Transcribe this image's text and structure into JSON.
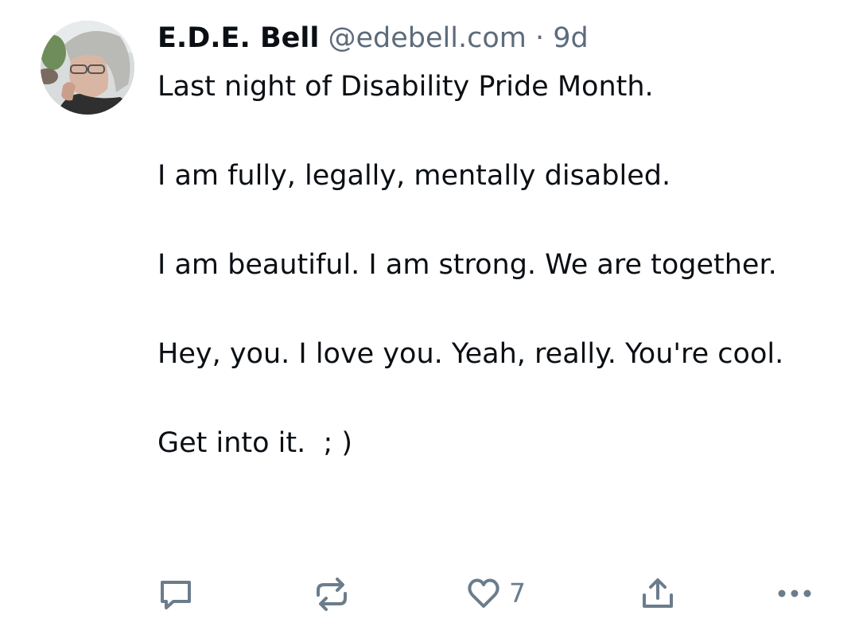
{
  "post": {
    "author": {
      "display_name": "E.D.E. Bell",
      "handle": "@edebell.com",
      "separator": "·",
      "age": "9d"
    },
    "paragraphs": [
      "Last night of Disability Pride Month.",
      "I am fully, legally, mentally disabled.",
      "I am beautiful. I am strong. We are together.",
      "Hey, you. I love you. Yeah, really. You're cool.",
      "Get into it.  ; )"
    ],
    "actions": {
      "reply_icon": "speech-bubble-icon",
      "repost_icon": "repost-arrows-icon",
      "like_icon": "heart-icon",
      "like_count": "7",
      "share_icon": "share-upload-icon",
      "more_icon": "ellipsis-icon"
    },
    "colors": {
      "text": "#0b0f14",
      "muted": "#5d6b7b",
      "icon": "#6b7c8c"
    }
  }
}
